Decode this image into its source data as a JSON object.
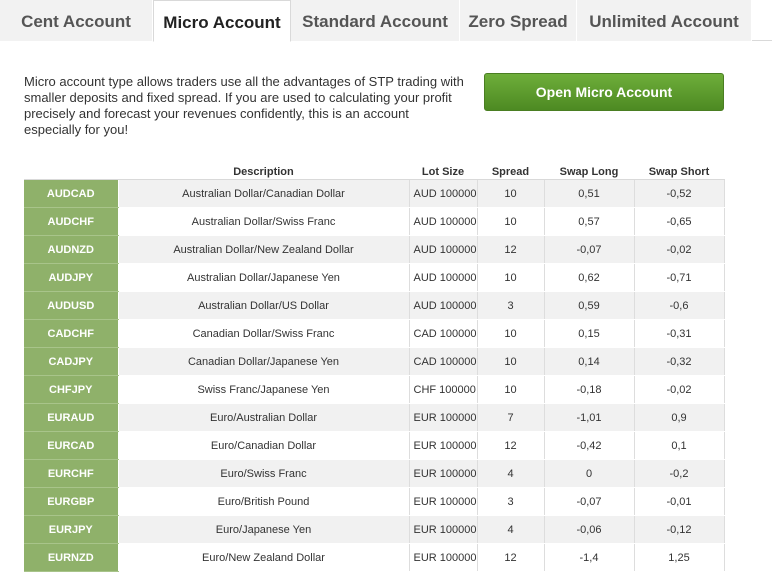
{
  "tabs": [
    {
      "label": "Cent Account",
      "active": false
    },
    {
      "label": "Micro Account",
      "active": true
    },
    {
      "label": "Standard Account",
      "active": false
    },
    {
      "label": "Zero Spread",
      "active": false
    },
    {
      "label": "Unlimited Account",
      "active": false
    }
  ],
  "intro": {
    "text": "Micro account type allows traders use all the advantages of STP trading with smaller deposits and fixed spread. If you are used to calculating your profit precisely and forecast your revenues confidently, this is an account especially for you!"
  },
  "open_button": {
    "label": "Open Micro Account"
  },
  "colors": {
    "accent_green": "#5c9a2c",
    "symbol_cell": "#8fb16a"
  },
  "table": {
    "headers": {
      "symbol": "",
      "description": "Description",
      "lot_size": "Lot Size",
      "spread": "Spread",
      "swap_long": "Swap Long",
      "swap_short": "Swap Short"
    },
    "rows": [
      {
        "symbol": "AUDCAD",
        "description": "Australian Dollar/Canadian Dollar",
        "lot_size": "AUD 100000",
        "spread": "10",
        "swap_long": "0,51",
        "swap_short": "-0,52"
      },
      {
        "symbol": "AUDCHF",
        "description": "Australian Dollar/Swiss Franc",
        "lot_size": "AUD 100000",
        "spread": "10",
        "swap_long": "0,57",
        "swap_short": "-0,65"
      },
      {
        "symbol": "AUDNZD",
        "description": "Australian Dollar/New Zealand Dollar",
        "lot_size": "AUD 100000",
        "spread": "12",
        "swap_long": "-0,07",
        "swap_short": "-0,02"
      },
      {
        "symbol": "AUDJPY",
        "description": "Australian Dollar/Japanese Yen",
        "lot_size": "AUD 100000",
        "spread": "10",
        "swap_long": "0,62",
        "swap_short": "-0,71"
      },
      {
        "symbol": "AUDUSD",
        "description": "Australian Dollar/US Dollar",
        "lot_size": "AUD 100000",
        "spread": "3",
        "swap_long": "0,59",
        "swap_short": "-0,6"
      },
      {
        "symbol": "CADCHF",
        "description": "Canadian Dollar/Swiss Franc",
        "lot_size": "CAD 100000",
        "spread": "10",
        "swap_long": "0,15",
        "swap_short": "-0,31"
      },
      {
        "symbol": "CADJPY",
        "description": "Canadian Dollar/Japanese Yen",
        "lot_size": "CAD 100000",
        "spread": "10",
        "swap_long": "0,14",
        "swap_short": "-0,32"
      },
      {
        "symbol": "CHFJPY",
        "description": "Swiss Franc/Japanese Yen",
        "lot_size": "CHF 100000",
        "spread": "10",
        "swap_long": "-0,18",
        "swap_short": "-0,02"
      },
      {
        "symbol": "EURAUD",
        "description": "Euro/Australian Dollar",
        "lot_size": "EUR 100000",
        "spread": "7",
        "swap_long": "-1,01",
        "swap_short": "0,9"
      },
      {
        "symbol": "EURCAD",
        "description": "Euro/Canadian Dollar",
        "lot_size": "EUR 100000",
        "spread": "12",
        "swap_long": "-0,42",
        "swap_short": "0,1"
      },
      {
        "symbol": "EURCHF",
        "description": "Euro/Swiss Franc",
        "lot_size": "EUR 100000",
        "spread": "4",
        "swap_long": "0",
        "swap_short": "-0,2"
      },
      {
        "symbol": "EURGBP",
        "description": "Euro/British Pound",
        "lot_size": "EUR 100000",
        "spread": "3",
        "swap_long": "-0,07",
        "swap_short": "-0,01"
      },
      {
        "symbol": "EURJPY",
        "description": "Euro/Japanese Yen",
        "lot_size": "EUR 100000",
        "spread": "4",
        "swap_long": "-0,06",
        "swap_short": "-0,12"
      },
      {
        "symbol": "EURNZD",
        "description": "Euro/New Zealand Dollar",
        "lot_size": "EUR 100000",
        "spread": "12",
        "swap_long": "-1,4",
        "swap_short": "1,25"
      }
    ]
  }
}
